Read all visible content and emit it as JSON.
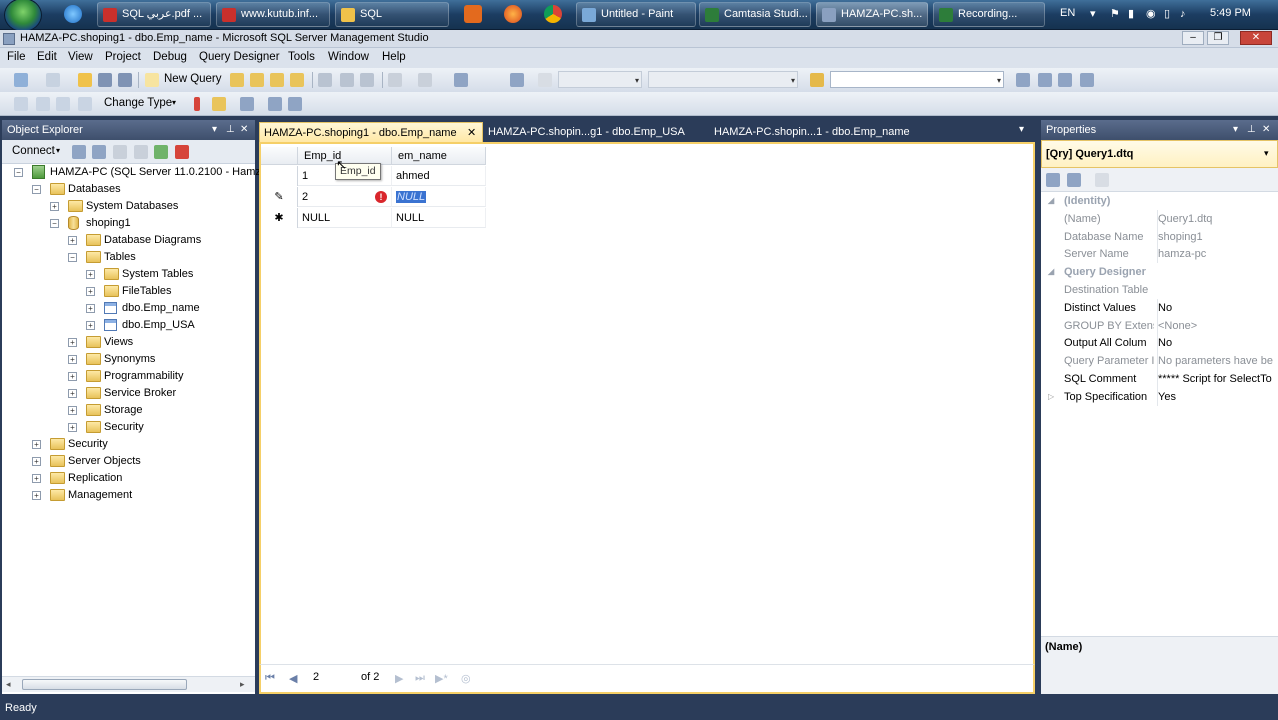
{
  "taskbar": {
    "buttons": [
      "SQL عربي.pdf ...",
      "www.kutub.inf...",
      "SQL",
      "Untitled - Paint",
      "Camtasia Studi...",
      "HAMZA-PC.sh...",
      "Recording..."
    ],
    "lang": "EN",
    "time": "5:49 PM"
  },
  "window": {
    "title": "HAMZA-PC.shoping1 - dbo.Emp_name - Microsoft SQL Server Management Studio"
  },
  "menu": [
    "File",
    "Edit",
    "View",
    "Project",
    "Debug",
    "Query Designer",
    "Tools",
    "Window",
    "Help"
  ],
  "toolbar": {
    "new_query": "New Query",
    "change_type": "Change Type"
  },
  "object_explorer": {
    "title": "Object Explorer",
    "connect": "Connect",
    "tree": [
      {
        "label": "HAMZA-PC (SQL Server 11.0.2100 - Hamz",
        "kind": "server",
        "expander": "−"
      },
      {
        "label": "Databases",
        "kind": "folder",
        "expander": "−"
      },
      {
        "label": "System Databases",
        "kind": "folder",
        "expander": "+"
      },
      {
        "label": "shoping1",
        "kind": "db",
        "expander": "−"
      },
      {
        "label": "Database Diagrams",
        "kind": "folder",
        "expander": "+"
      },
      {
        "label": "Tables",
        "kind": "folder",
        "expander": "−"
      },
      {
        "label": "System Tables",
        "kind": "folder",
        "expander": "+"
      },
      {
        "label": "FileTables",
        "kind": "folder",
        "expander": "+"
      },
      {
        "label": "dbo.Emp_name",
        "kind": "table",
        "expander": "+"
      },
      {
        "label": "dbo.Emp_USA",
        "kind": "table",
        "expander": "+"
      },
      {
        "label": "Views",
        "kind": "folder",
        "expander": "+"
      },
      {
        "label": "Synonyms",
        "kind": "folder",
        "expander": "+"
      },
      {
        "label": "Programmability",
        "kind": "folder",
        "expander": "+"
      },
      {
        "label": "Service Broker",
        "kind": "folder",
        "expander": "+"
      },
      {
        "label": "Storage",
        "kind": "folder",
        "expander": "+"
      },
      {
        "label": "Security",
        "kind": "folder",
        "expander": "+"
      },
      {
        "label": "Security",
        "kind": "folder",
        "expander": "+"
      },
      {
        "label": "Server Objects",
        "kind": "folder",
        "expander": "+"
      },
      {
        "label": "Replication",
        "kind": "folder",
        "expander": "+"
      },
      {
        "label": "Management",
        "kind": "folder",
        "expander": "+"
      }
    ]
  },
  "doc_tabs": [
    "HAMZA-PC.shoping1 - dbo.Emp_name",
    "HAMZA-PC.shopin...g1 - dbo.Emp_USA",
    "HAMZA-PC.shopin...1 - dbo.Emp_name"
  ],
  "grid": {
    "columns": [
      "Emp_id",
      "em_name"
    ],
    "tooltip": "Emp_id",
    "rows": [
      {
        "marker": "",
        "id": "1",
        "name": "ahmed"
      },
      {
        "marker": "✎",
        "id": "2",
        "name": "NULL"
      },
      {
        "marker": "✱",
        "id": "NULL",
        "name": "NULL"
      }
    ]
  },
  "navigator": {
    "current": "2",
    "total": "of 2"
  },
  "properties": {
    "title": "Properties",
    "object": "[Qry] Query1.dtq",
    "rows": [
      {
        "k": "(Identity)",
        "v": "",
        "cat": true
      },
      {
        "k": "(Name)",
        "v": "Query1.dtq",
        "dim": true
      },
      {
        "k": "Database Name",
        "v": "shoping1",
        "dim": true
      },
      {
        "k": "Server Name",
        "v": "hamza-pc",
        "dim": true
      },
      {
        "k": "Query Designer",
        "v": "",
        "cat": true
      },
      {
        "k": "Destination Table",
        "v": "",
        "dim": true
      },
      {
        "k": "Distinct Values",
        "v": "No"
      },
      {
        "k": "GROUP BY Extensi",
        "v": "<None>",
        "dim": true
      },
      {
        "k": "Output All Colum",
        "v": "No"
      },
      {
        "k": "Query Parameter I",
        "v": "No parameters have be",
        "dim": true
      },
      {
        "k": "SQL Comment",
        "v": "***** Script for SelectTo"
      },
      {
        "k": "Top Specification",
        "v": "Yes"
      }
    ],
    "desc": "(Name)"
  },
  "status": "Ready",
  "colors": {
    "accent": "#f5cf67",
    "chrome": "#2b3c59",
    "selection": "#3a73d1"
  }
}
